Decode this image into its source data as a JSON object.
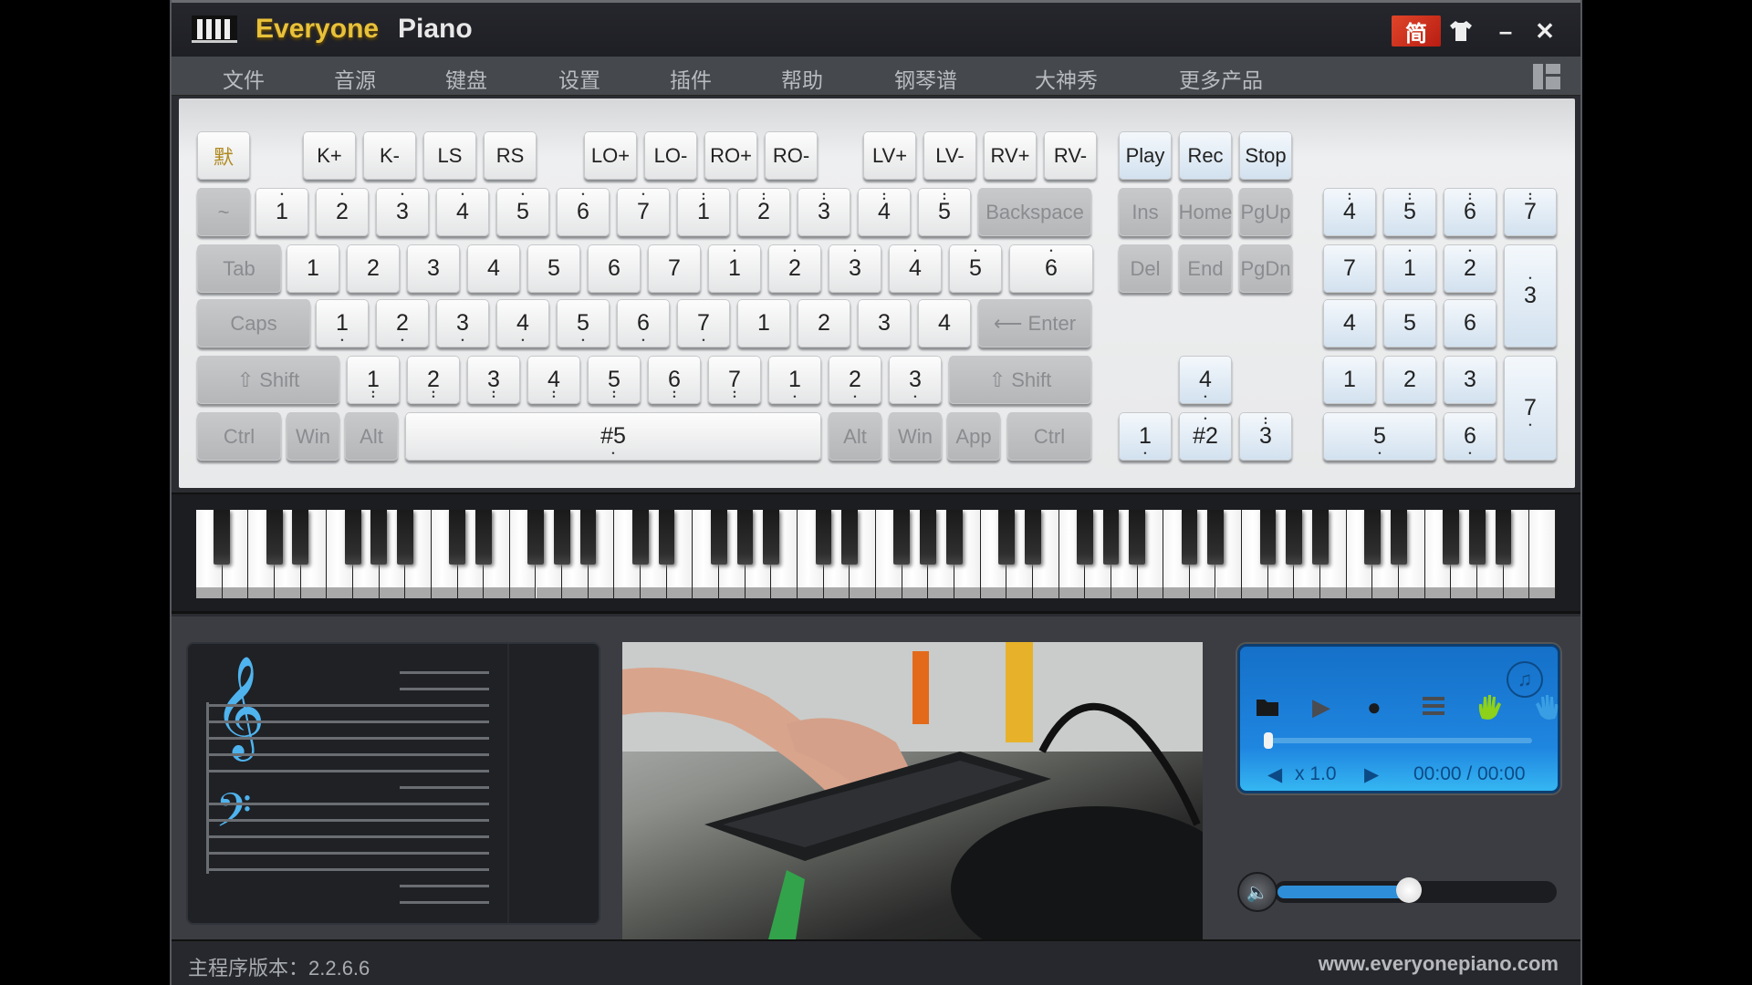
{
  "titlebar": {
    "title_part1": "Everyone",
    "title_part2": "Piano",
    "language_button": "简",
    "skin_icon": "shirt-icon",
    "minimize_label": "–",
    "close_label": "✕"
  },
  "menu": {
    "items": [
      "文件",
      "音源",
      "键盘",
      "设置",
      "插件",
      "帮助",
      "钢琴谱",
      "大神秀",
      "更多产品"
    ]
  },
  "keyboard": {
    "top_row": {
      "default_label": "默",
      "transpose": [
        "K+",
        "K-",
        "LS",
        "RS"
      ],
      "octave": [
        "LO+",
        "LO-",
        "RO+",
        "RO-"
      ],
      "velocity": [
        "LV+",
        "LV-",
        "RV+",
        "RV-"
      ],
      "playback": [
        "Play",
        "Rec",
        "Stop"
      ]
    },
    "row1": {
      "tilde": "~",
      "keys": [
        {
          "n": "1",
          "d": 1
        },
        {
          "n": "2",
          "d": 1
        },
        {
          "n": "3",
          "d": 1
        },
        {
          "n": "4",
          "d": 1
        },
        {
          "n": "5",
          "d": 1
        },
        {
          "n": "6",
          "d": 1
        },
        {
          "n": "7",
          "d": 1
        },
        {
          "n": "1",
          "d": 2
        },
        {
          "n": "2",
          "d": 2
        },
        {
          "n": "3",
          "d": 2
        },
        {
          "n": "4",
          "d": 2
        },
        {
          "n": "5",
          "d": 2
        }
      ],
      "backspace": "Backspace"
    },
    "row2": {
      "tab": "Tab",
      "keys": [
        {
          "n": "1",
          "d": 0
        },
        {
          "n": "2",
          "d": 0
        },
        {
          "n": "3",
          "d": 0
        },
        {
          "n": "4",
          "d": 0
        },
        {
          "n": "5",
          "d": 0
        },
        {
          "n": "6",
          "d": 0
        },
        {
          "n": "7",
          "d": 0
        },
        {
          "n": "1",
          "d": 1
        },
        {
          "n": "2",
          "d": 1
        },
        {
          "n": "3",
          "d": 1
        },
        {
          "n": "4",
          "d": 1
        },
        {
          "n": "5",
          "d": 1
        },
        {
          "n": "6",
          "d": 1
        }
      ]
    },
    "row3": {
      "caps": "Caps",
      "keys": [
        {
          "n": "1",
          "d": -1
        },
        {
          "n": "2",
          "d": -1
        },
        {
          "n": "3",
          "d": -1
        },
        {
          "n": "4",
          "d": -1
        },
        {
          "n": "5",
          "d": -1
        },
        {
          "n": "6",
          "d": -1
        },
        {
          "n": "7",
          "d": -1
        },
        {
          "n": "1",
          "d": 0
        },
        {
          "n": "2",
          "d": 0
        },
        {
          "n": "3",
          "d": 0
        },
        {
          "n": "4",
          "d": 0
        }
      ],
      "enter": "Enter"
    },
    "row4": {
      "shift": "Shift",
      "keys": [
        {
          "n": "1",
          "d": -2
        },
        {
          "n": "2",
          "d": -2
        },
        {
          "n": "3",
          "d": -2
        },
        {
          "n": "4",
          "d": -2
        },
        {
          "n": "5",
          "d": -2
        },
        {
          "n": "6",
          "d": -2
        },
        {
          "n": "7",
          "d": -2
        },
        {
          "n": "1",
          "d": -1
        },
        {
          "n": "2",
          "d": -1
        },
        {
          "n": "3",
          "d": -1
        }
      ],
      "shift_right": "Shift"
    },
    "row5": {
      "ctrl": "Ctrl",
      "win": "Win",
      "alt": "Alt",
      "space": {
        "n": "#5",
        "d": -1
      },
      "alt_right": "Alt",
      "win_right": "Win",
      "app": "App",
      "ctrl_right": "Ctrl"
    },
    "nav": {
      "row1": [
        "Ins",
        "Home",
        "PgUp"
      ],
      "row2": [
        "Del",
        "End",
        "PgDn"
      ],
      "arrow_up": {
        "n": "4",
        "d": -1
      },
      "arrow_left": {
        "n": "1",
        "d": -1
      },
      "arrow_down": {
        "n": "#2",
        "d": 1
      },
      "arrow_right": {
        "n": "3",
        "d": 2
      }
    },
    "numpad": {
      "row1": [
        {
          "n": "4",
          "d": 2
        },
        {
          "n": "5",
          "d": 2
        },
        {
          "n": "6",
          "d": 2
        },
        {
          "n": "7",
          "d": 2
        }
      ],
      "row2": [
        {
          "n": "7",
          "d": 0
        },
        {
          "n": "1",
          "d": 1
        },
        {
          "n": "2",
          "d": 1
        }
      ],
      "plus": {
        "n": "3",
        "d": 1
      },
      "row3": [
        {
          "n": "4",
          "d": 0
        },
        {
          "n": "5",
          "d": 0
        },
        {
          "n": "6",
          "d": 0
        }
      ],
      "row4": [
        {
          "n": "1",
          "d": 0
        },
        {
          "n": "2",
          "d": 0
        },
        {
          "n": "3",
          "d": 0
        }
      ],
      "enter": {
        "n": "7",
        "d": -1
      },
      "zero": {
        "n": "5",
        "d": -1
      },
      "dot": {
        "n": "6",
        "d": -1
      }
    }
  },
  "player": {
    "speed": "x 1.0",
    "time": "00:00 / 00:00",
    "progress_percent": 0,
    "volume_percent": 48,
    "buttons": [
      "folder-icon",
      "play-icon",
      "record-icon",
      "list-icon",
      "left-hand-icon",
      "right-hand-icon"
    ]
  },
  "colors": {
    "left_hand": "#8dd11a",
    "right_hand": "#3a9ee4",
    "clef": "#4fb3ee",
    "title_gold": "#e8c13a"
  },
  "status": {
    "version": "主程序版本：2.2.6.6",
    "website": "www.everyonepiano.com"
  }
}
